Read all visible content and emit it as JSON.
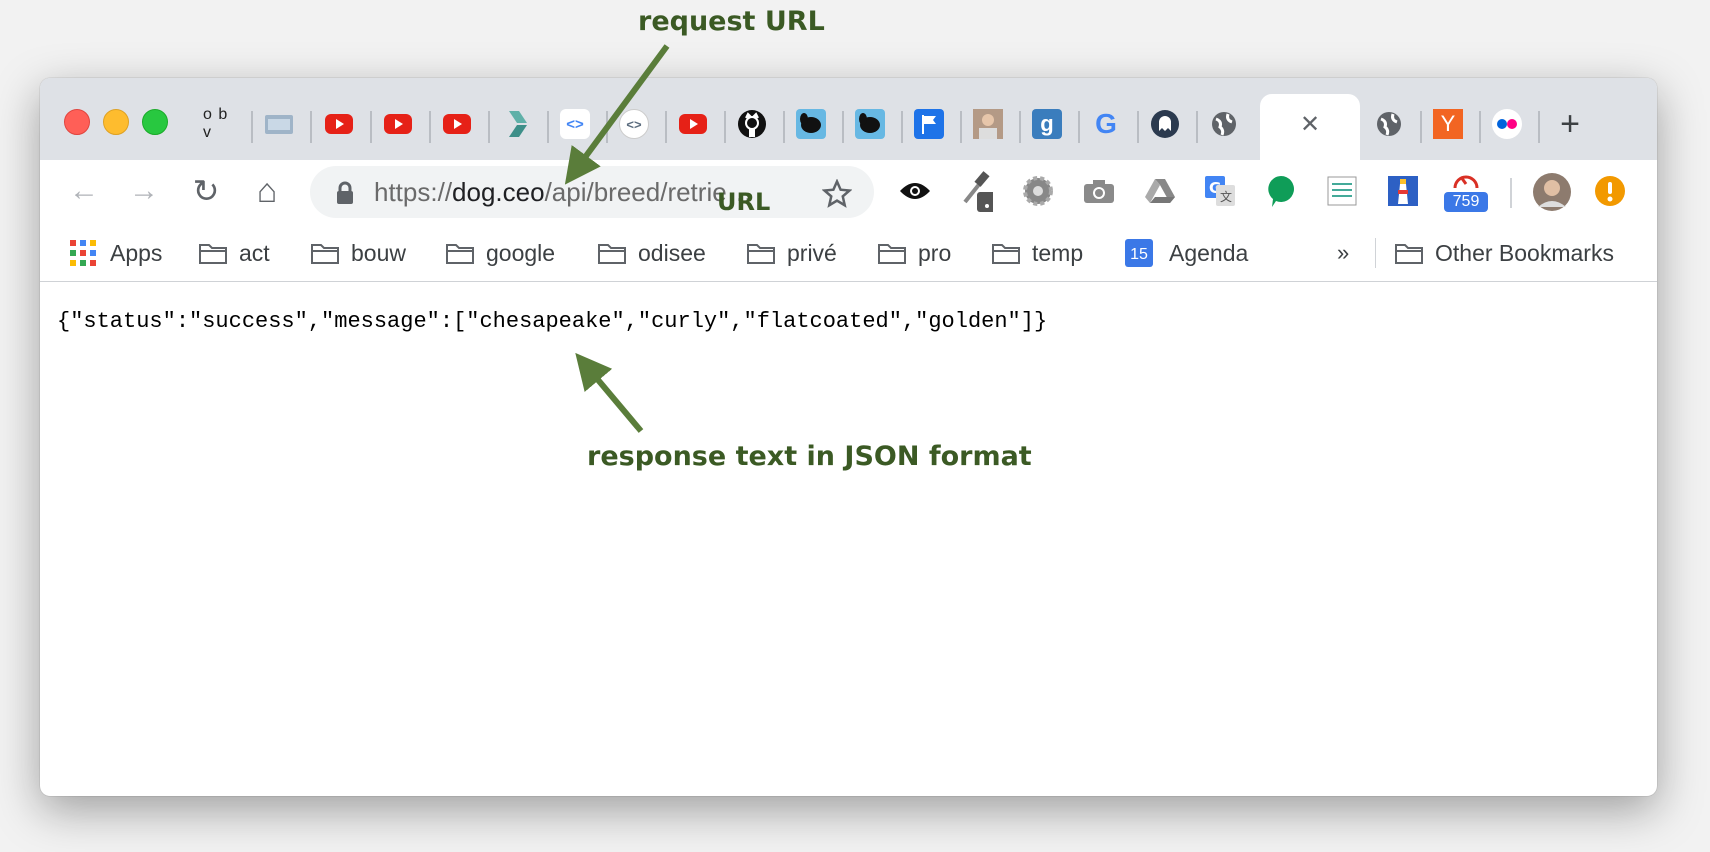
{
  "annotations": {
    "request_url_label": "request URL",
    "url_label": "URL",
    "response_label": "response text in JSON format",
    "color": "#5a7d3a"
  },
  "tabs": [
    {
      "icon": "obv-icon",
      "text": "o b v"
    },
    {
      "icon": "finder-icon"
    },
    {
      "icon": "youtube-icon"
    },
    {
      "icon": "youtube-icon"
    },
    {
      "icon": "youtube-icon"
    },
    {
      "icon": "pen-icon"
    },
    {
      "icon": "code-icon",
      "text": "<>"
    },
    {
      "icon": "brackets-icon",
      "text": "<>"
    },
    {
      "icon": "youtube-icon"
    },
    {
      "icon": "github-icon"
    },
    {
      "icon": "dog-icon"
    },
    {
      "icon": "dog-icon"
    },
    {
      "icon": "flag-icon"
    },
    {
      "icon": "avatar-icon"
    },
    {
      "icon": "goodreads-icon",
      "text": "g"
    },
    {
      "icon": "google-icon",
      "text": "G"
    },
    {
      "icon": "ghost-icon"
    },
    {
      "icon": "globe-icon"
    },
    {
      "icon": "close-icon",
      "text": "✕",
      "active": true
    },
    {
      "icon": "globe-icon"
    },
    {
      "icon": "ycombinator-icon",
      "text": "Y"
    },
    {
      "icon": "flickr-icon"
    }
  ],
  "new_tab_label": "+",
  "toolbar": {
    "back_icon": "←",
    "forward_icon": "→",
    "reload_icon": "↻",
    "home_icon": "⌂",
    "url_prefix": "https://",
    "url_host": "dog.ceo",
    "url_path": "/api/breed/retrie…",
    "badge_count": "759"
  },
  "bookmarks": {
    "apps": "Apps",
    "items": [
      "act",
      "bouw",
      "google",
      "odisee",
      "privé",
      "pro",
      "temp"
    ],
    "agenda": "Agenda",
    "agenda_day": "15",
    "overflow": "»",
    "other": "Other Bookmarks"
  },
  "page": {
    "json_text": "{\"status\":\"success\",\"message\":[\"chesapeake\",\"curly\",\"flatcoated\",\"golden\"]}"
  }
}
